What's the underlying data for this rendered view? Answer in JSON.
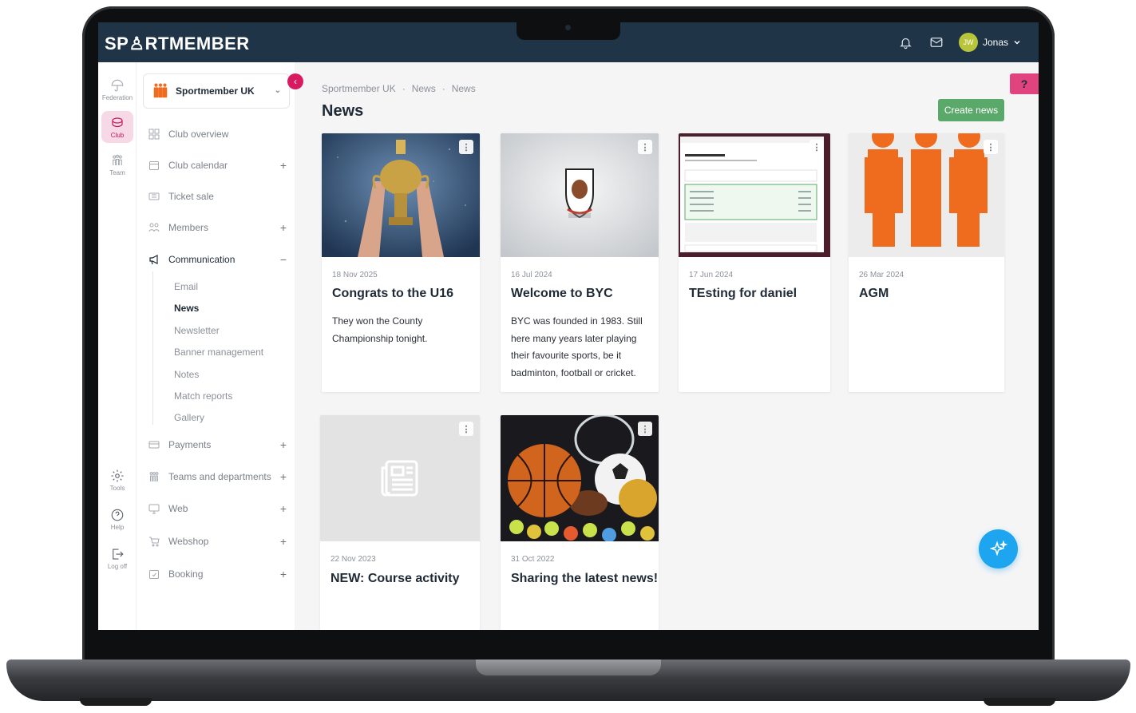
{
  "app": {
    "logo_text": "SP♙RTMEMBER",
    "user_initials": "JW",
    "user_name": "Jonas"
  },
  "rail": {
    "federation": "Federation",
    "club": "Club",
    "team": "Team",
    "tools": "Tools",
    "help": "Help",
    "logoff": "Log off"
  },
  "club_selector": {
    "name": "Sportmember UK"
  },
  "menu": {
    "club_overview": "Club overview",
    "club_calendar": "Club calendar",
    "ticket_sale": "Ticket sale",
    "members": "Members",
    "communication": "Communication",
    "communication_sub": [
      "Email",
      "News",
      "Newsletter",
      "Banner management",
      "Notes",
      "Match reports",
      "Gallery"
    ],
    "payments": "Payments",
    "teams_departments": "Teams and departments",
    "web": "Web",
    "webshop": "Webshop",
    "booking": "Booking",
    "plus": "+",
    "minus": "−"
  },
  "breadcrumb": [
    "Sportmember UK",
    "News",
    "News"
  ],
  "breadcrumb_sep": "·",
  "page_title": "News",
  "create_button": "Create news",
  "help_tab": "?",
  "cards": [
    {
      "date": "18 Nov 2025",
      "title": "Congrats to the U16",
      "text": "They won the County Championship tonight.",
      "image": "trophy-photo"
    },
    {
      "date": "16 Jul 2024",
      "title": "Welcome to BYC",
      "text": "BYC was founded in 1983. Still here many years later playing their favourite sports, be it badminton, football or cricket.",
      "image": "club-crest"
    },
    {
      "date": "17 Jun 2024",
      "title": "TEsting for daniel",
      "text": "",
      "image": "payment-screenshot"
    },
    {
      "date": "26 Mar 2024",
      "title": "AGM",
      "text": "",
      "image": "members-logo"
    },
    {
      "date": "22 Nov 2023",
      "title": "NEW: Course activity",
      "text": "",
      "image": "newspaper-placeholder"
    },
    {
      "date": "31 Oct 2022",
      "title": "Sharing the latest news!",
      "text": "",
      "image": "sports-balls-photo"
    }
  ],
  "card_menu_glyph": "⋮",
  "colors": {
    "header": "#1f3447",
    "accent_pink": "#d81b60",
    "create_green": "#5aa86a",
    "fab_blue": "#1ea5ef"
  }
}
